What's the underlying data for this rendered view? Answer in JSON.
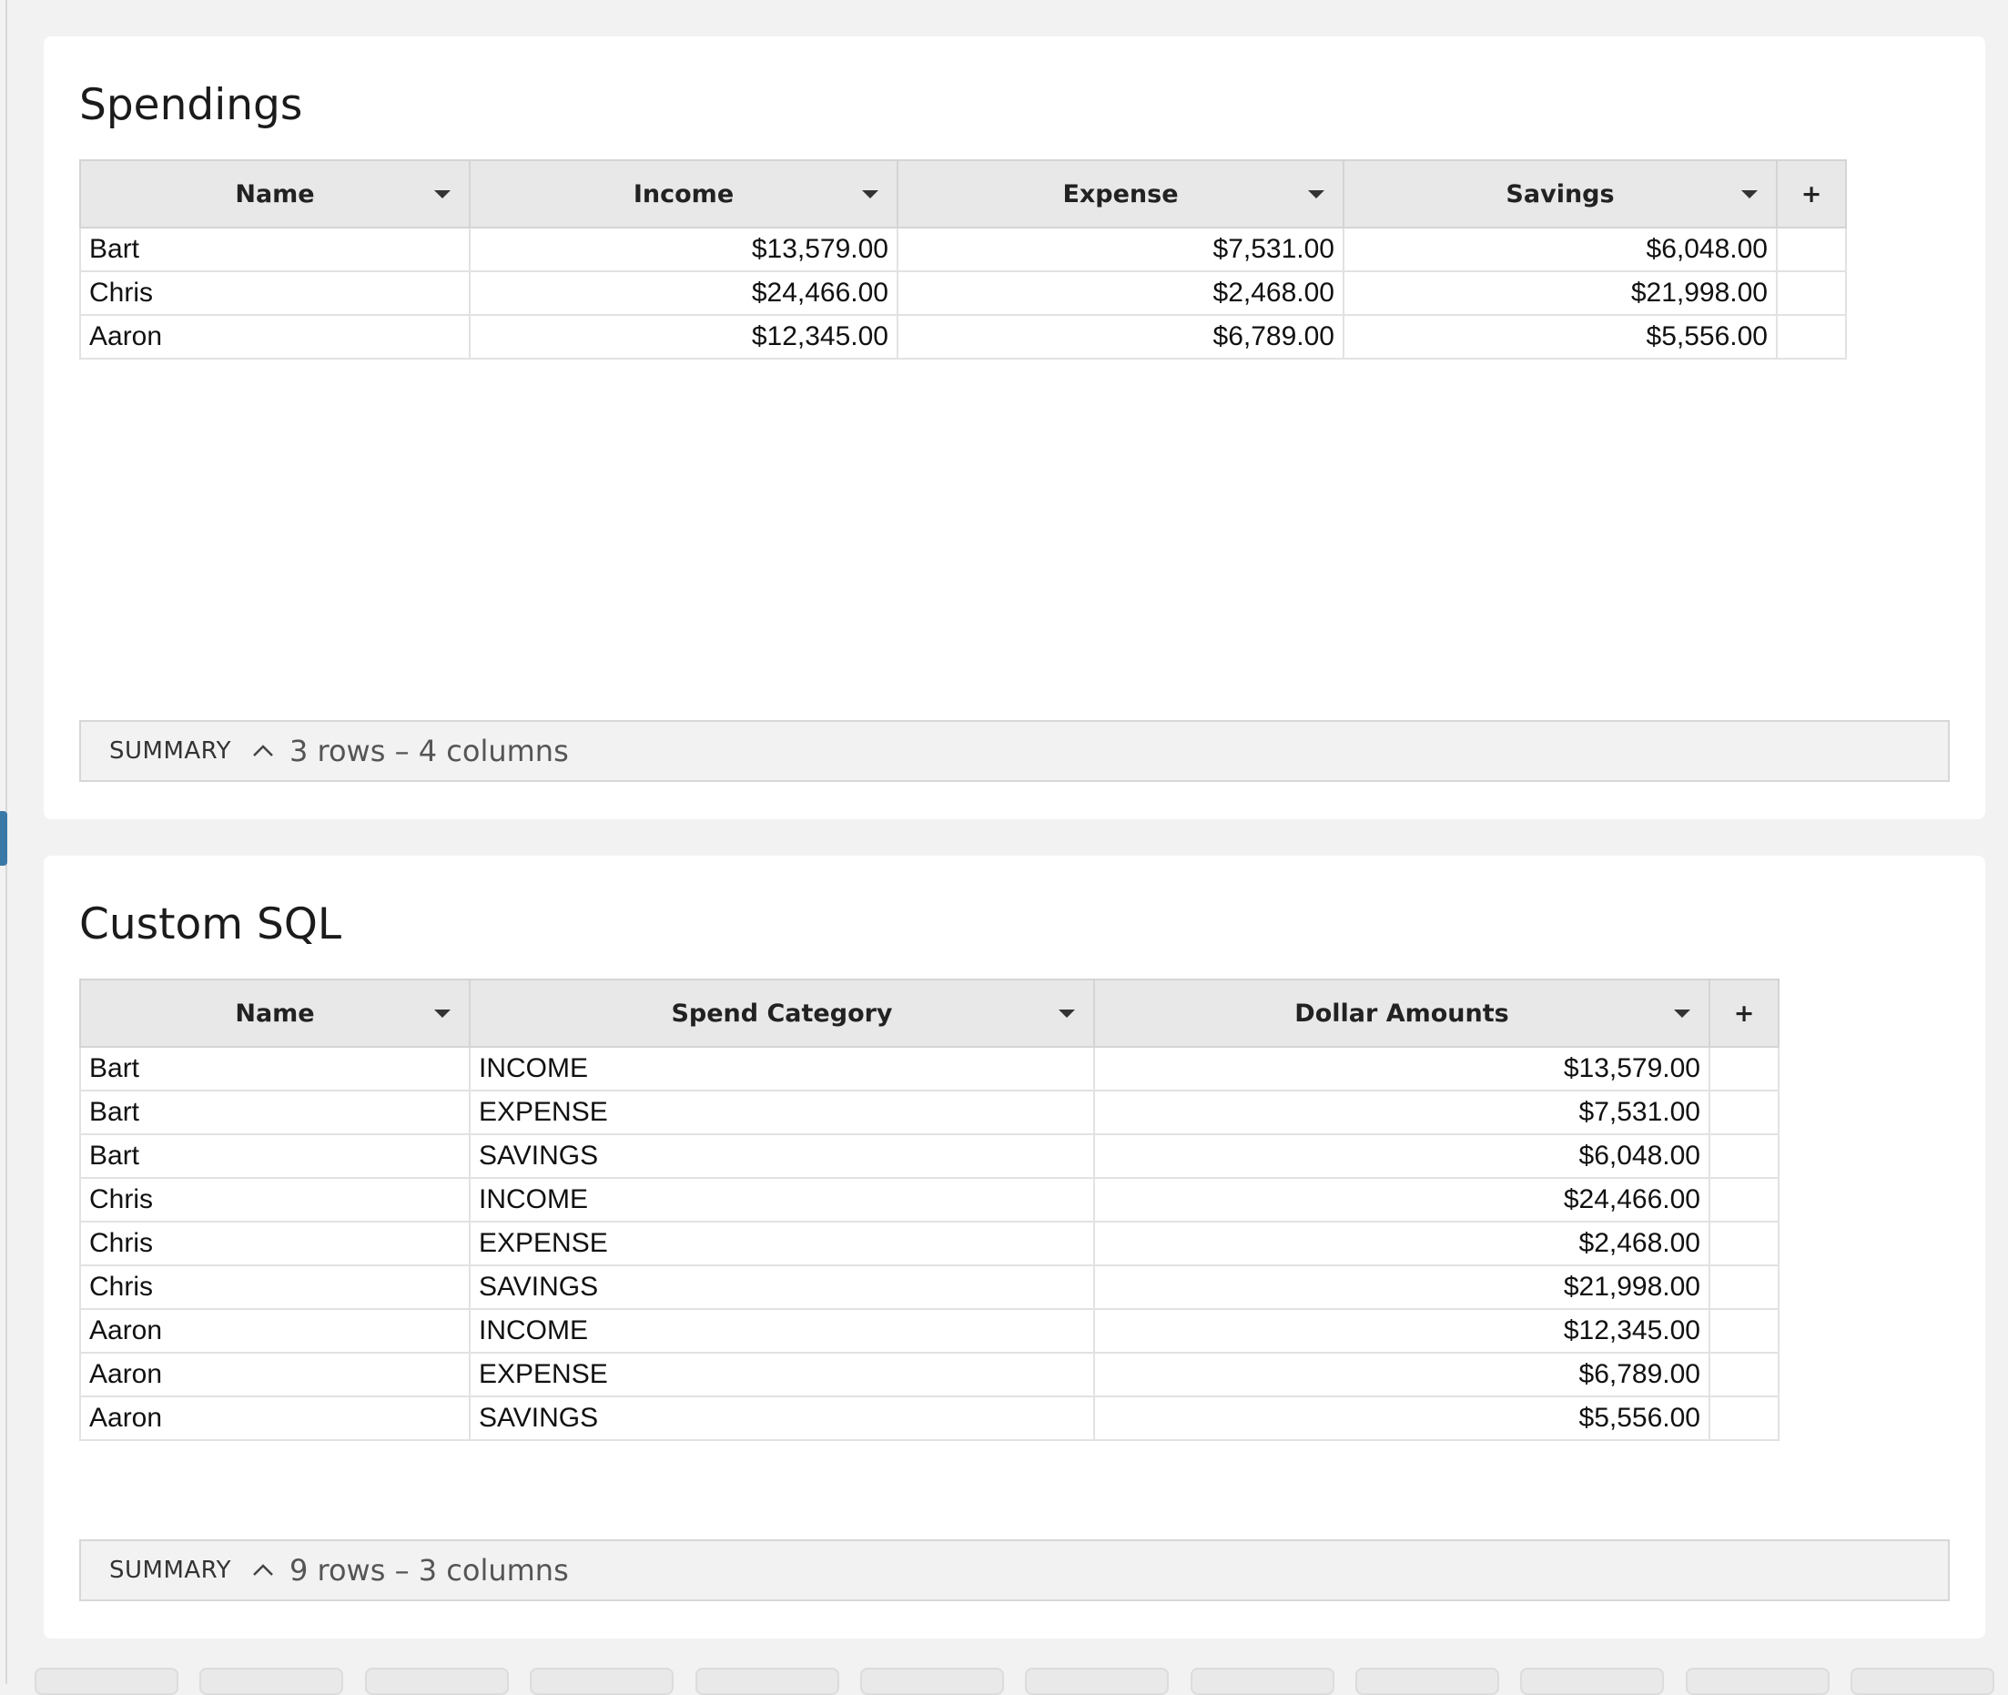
{
  "spendings": {
    "title": "Spendings",
    "columns": [
      "Name",
      "Income",
      "Expense",
      "Savings"
    ],
    "add_column": "+",
    "rows": [
      [
        "Bart",
        "$13,579.00",
        "$7,531.00",
        "$6,048.00"
      ],
      [
        "Chris",
        "$24,466.00",
        "$2,468.00",
        "$21,998.00"
      ],
      [
        "Aaron",
        "$12,345.00",
        "$6,789.00",
        "$5,556.00"
      ]
    ],
    "summary": {
      "label": "SUMMARY",
      "counts": "3 rows – 4 columns"
    }
  },
  "custom_sql": {
    "title": "Custom SQL",
    "columns": [
      "Name",
      "Spend Category",
      "Dollar Amounts"
    ],
    "add_column": "+",
    "rows": [
      [
        "Bart",
        "INCOME",
        "$13,579.00"
      ],
      [
        "Bart",
        "EXPENSE",
        "$7,531.00"
      ],
      [
        "Bart",
        "SAVINGS",
        "$6,048.00"
      ],
      [
        "Chris",
        "INCOME",
        "$24,466.00"
      ],
      [
        "Chris",
        "EXPENSE",
        "$2,468.00"
      ],
      [
        "Chris",
        "SAVINGS",
        "$21,998.00"
      ],
      [
        "Aaron",
        "INCOME",
        "$12,345.00"
      ],
      [
        "Aaron",
        "EXPENSE",
        "$6,789.00"
      ],
      [
        "Aaron",
        "SAVINGS",
        "$5,556.00"
      ]
    ],
    "summary": {
      "label": "SUMMARY",
      "counts": "9 rows – 3 columns"
    }
  },
  "icons": {
    "column_menu": "caret-down-icon",
    "summary_toggle": "chevron-up-icon"
  }
}
